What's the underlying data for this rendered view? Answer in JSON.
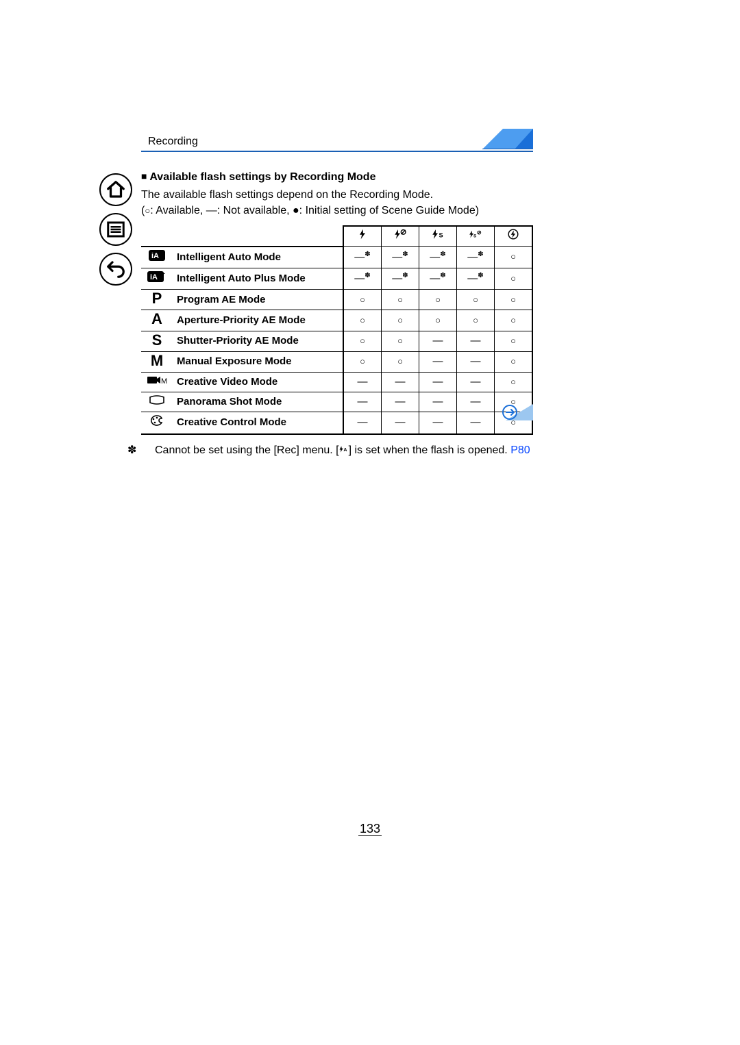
{
  "header": {
    "section": "Recording"
  },
  "section_title": "Available flash settings by Recording Mode",
  "intro_line": "The available flash settings depend on the Recording Mode.",
  "legend": {
    "available": "Available",
    "not_available": "Not available",
    "initial": "Initial setting of Scene Guide Mode"
  },
  "flash_columns": [
    {
      "id": "forced"
    },
    {
      "id": "forced_redeye"
    },
    {
      "id": "slow_sync"
    },
    {
      "id": "slow_sync_redeye"
    },
    {
      "id": "forced_off"
    }
  ],
  "modes": [
    {
      "icon": "iA",
      "name": "Intelligent Auto Mode",
      "cells": [
        "dash_ast",
        "dash_ast",
        "dash_ast",
        "dash_ast",
        "circ"
      ]
    },
    {
      "icon": "iA_plus",
      "name": "Intelligent Auto Plus Mode",
      "cells": [
        "dash_ast",
        "dash_ast",
        "dash_ast",
        "dash_ast",
        "circ"
      ]
    },
    {
      "icon": "P",
      "name": "Program AE Mode",
      "cells": [
        "circ",
        "circ",
        "circ",
        "circ",
        "circ"
      ]
    },
    {
      "icon": "A",
      "name": "Aperture-Priority AE Mode",
      "cells": [
        "circ",
        "circ",
        "circ",
        "circ",
        "circ"
      ]
    },
    {
      "icon": "S",
      "name": "Shutter-Priority AE Mode",
      "cells": [
        "circ",
        "circ",
        "dash",
        "dash",
        "circ"
      ]
    },
    {
      "icon": "M",
      "name": "Manual Exposure Mode",
      "cells": [
        "circ",
        "circ",
        "dash",
        "dash",
        "circ"
      ]
    },
    {
      "icon": "video_m",
      "name": "Creative Video Mode",
      "cells": [
        "dash",
        "dash",
        "dash",
        "dash",
        "circ"
      ]
    },
    {
      "icon": "panorama",
      "name": "Panorama Shot Mode",
      "cells": [
        "dash",
        "dash",
        "dash",
        "dash",
        "circ"
      ]
    },
    {
      "icon": "palette",
      "name": "Creative Control Mode",
      "cells": [
        "dash",
        "dash",
        "dash",
        "dash",
        "circ"
      ]
    }
  ],
  "footnote": {
    "marker": "*",
    "text_a": "Cannot be set using the [Rec] menu. [",
    "text_b": "] is set when the flash is opened. ",
    "link_text": "P80"
  },
  "page_number": "133"
}
